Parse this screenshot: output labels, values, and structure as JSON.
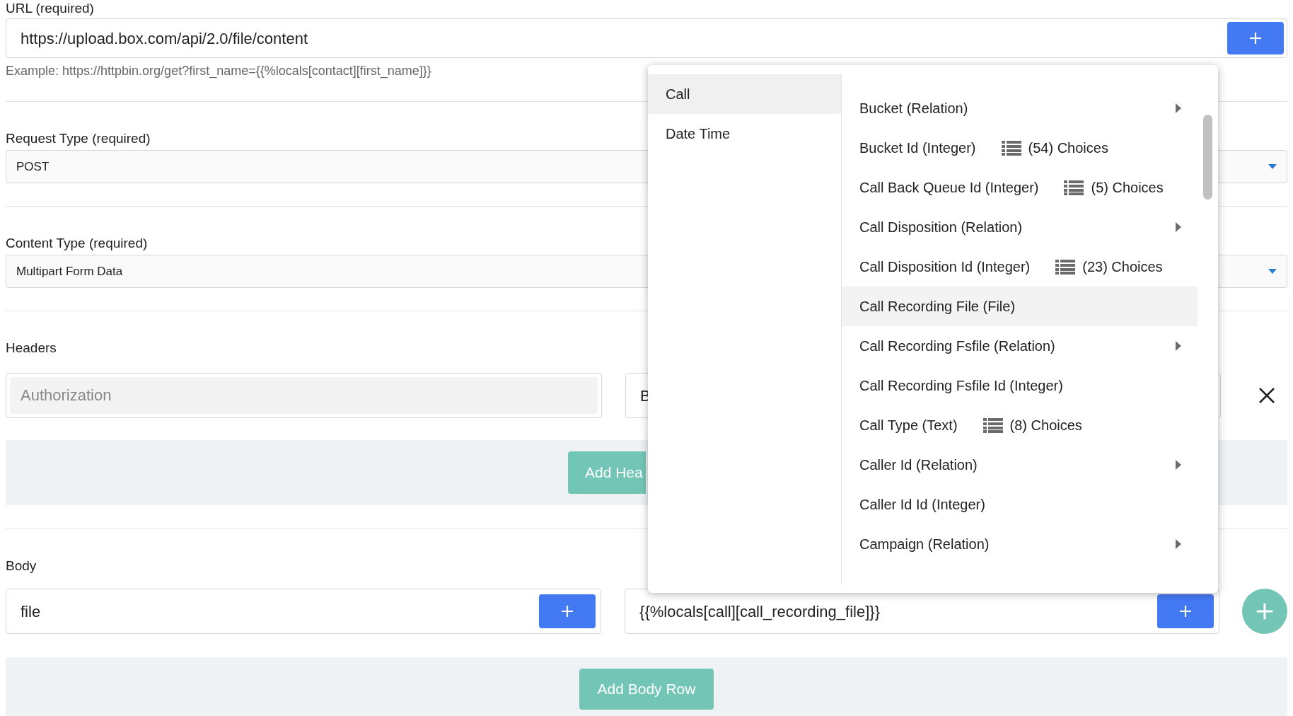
{
  "url": {
    "label": "URL (required)",
    "value": "https://upload.box.com/api/2.0/file/content",
    "hint": "Example: https://httpbin.org/get?first_name={{%locals[contact][first_name]}}"
  },
  "request_type": {
    "label": "Request Type (required)",
    "value": "POST"
  },
  "content_type": {
    "label": "Content Type (required)",
    "value": "Multipart Form Data"
  },
  "headers": {
    "label": "Headers",
    "rows": [
      {
        "key_placeholder": "Authorization",
        "value": "B"
      }
    ],
    "add_button": "Add Hea"
  },
  "body": {
    "label": "Body",
    "rows": [
      {
        "key": "file",
        "value": "{{%locals[call][call_recording_file]}}"
      }
    ],
    "add_button": "Add Body Row"
  },
  "dropdown": {
    "categories": [
      {
        "label": "Call",
        "selected": true
      },
      {
        "label": "Date Time",
        "selected": false
      }
    ],
    "items": [
      {
        "kind": "relation",
        "label": "Bucket (Relation)",
        "selected": false
      },
      {
        "kind": "choices",
        "label": "Bucket Id (Integer)",
        "choices": "(54) Choices",
        "selected": false
      },
      {
        "kind": "choices",
        "label": "Call Back Queue Id (Integer)",
        "choices": "(5) Choices",
        "selected": false
      },
      {
        "kind": "relation",
        "label": "Call Disposition (Relation)",
        "selected": false
      },
      {
        "kind": "choices",
        "label": "Call Disposition Id (Integer)",
        "choices": "(23) Choices",
        "selected": false
      },
      {
        "kind": "plain",
        "label": "Call Recording File (File)",
        "selected": true
      },
      {
        "kind": "relation",
        "label": "Call Recording Fsfile (Relation)",
        "selected": false
      },
      {
        "kind": "plain",
        "label": "Call Recording Fsfile Id (Integer)",
        "selected": false
      },
      {
        "kind": "choices",
        "label": "Call Type (Text)",
        "choices": "(8) Choices",
        "selected": false
      },
      {
        "kind": "relation",
        "label": "Caller Id (Relation)",
        "selected": false
      },
      {
        "kind": "plain",
        "label": "Caller Id Id (Integer)",
        "selected": false
      },
      {
        "kind": "relation",
        "label": "Campaign (Relation)",
        "selected": false
      }
    ]
  }
}
